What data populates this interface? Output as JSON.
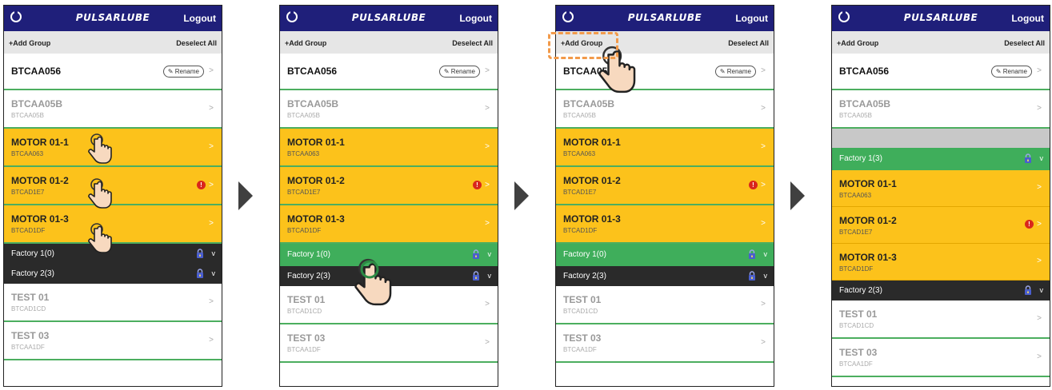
{
  "app": {
    "logo_text": "PULSARLUBE",
    "logout_label": "Logout",
    "add_group_label": "+Add Group",
    "deselect_label": "Deselect All",
    "rename_label": "Rename",
    "chevron": ">",
    "alert_glyph": "!",
    "group_chevron": "v"
  },
  "screens": [
    {
      "rows": [
        {
          "kind": "device",
          "style": "white",
          "title": "BTCAA056",
          "sub": "",
          "rename": true,
          "alert": false
        },
        {
          "kind": "device",
          "style": "gray",
          "title": "BTCAA05B",
          "sub": "BTCAA05B",
          "rename": false,
          "alert": false
        },
        {
          "kind": "device",
          "style": "yellow",
          "title": "MOTOR 01-1",
          "sub": "BTCAA063",
          "rename": false,
          "alert": false
        },
        {
          "kind": "device",
          "style": "yellow",
          "title": "MOTOR 01-2",
          "sub": "BTCAD1E7",
          "rename": false,
          "alert": true
        },
        {
          "kind": "device",
          "style": "yellow",
          "title": "MOTOR 01-3",
          "sub": "BTCAD1DF",
          "rename": false,
          "alert": false
        },
        {
          "kind": "group",
          "style": "dark",
          "title": "Factory 1(0)"
        },
        {
          "kind": "group",
          "style": "dark",
          "title": "Factory 2(3)"
        },
        {
          "kind": "device",
          "style": "gray",
          "title": "TEST 01",
          "sub": "BTCAD1CD",
          "rename": false,
          "alert": false
        },
        {
          "kind": "device",
          "style": "gray",
          "title": "TEST 03",
          "sub": "BTCAA1DF",
          "rename": false,
          "alert": false
        }
      ]
    },
    {
      "rows": [
        {
          "kind": "device",
          "style": "white",
          "title": "BTCAA056",
          "sub": "",
          "rename": true,
          "alert": false
        },
        {
          "kind": "device",
          "style": "gray",
          "title": "BTCAA05B",
          "sub": "BTCAA05B",
          "rename": false,
          "alert": false
        },
        {
          "kind": "device",
          "style": "yellow",
          "title": "MOTOR 01-1",
          "sub": "BTCAA063",
          "rename": false,
          "alert": false
        },
        {
          "kind": "device",
          "style": "yellow",
          "title": "MOTOR 01-2",
          "sub": "BTCAD1E7",
          "rename": false,
          "alert": true
        },
        {
          "kind": "device",
          "style": "yellow",
          "title": "MOTOR 01-3",
          "sub": "BTCAD1DF",
          "rename": false,
          "alert": false
        },
        {
          "kind": "group",
          "style": "green",
          "title": "Factory 1(0)"
        },
        {
          "kind": "group",
          "style": "dark",
          "title": "Factory 2(3)"
        },
        {
          "kind": "device",
          "style": "gray",
          "title": "TEST 01",
          "sub": "BTCAD1CD",
          "rename": false,
          "alert": false
        },
        {
          "kind": "device",
          "style": "gray",
          "title": "TEST 03",
          "sub": "BTCAA1DF",
          "rename": false,
          "alert": false
        }
      ]
    },
    {
      "rows": [
        {
          "kind": "device",
          "style": "white",
          "title": "BTCAA056",
          "sub": "",
          "rename": true,
          "alert": false
        },
        {
          "kind": "device",
          "style": "gray",
          "title": "BTCAA05B",
          "sub": "BTCAA05B",
          "rename": false,
          "alert": false
        },
        {
          "kind": "device",
          "style": "yellow",
          "title": "MOTOR 01-1",
          "sub": "BTCAA063",
          "rename": false,
          "alert": false
        },
        {
          "kind": "device",
          "style": "yellow",
          "title": "MOTOR 01-2",
          "sub": "BTCAD1E7",
          "rename": false,
          "alert": true
        },
        {
          "kind": "device",
          "style": "yellow",
          "title": "MOTOR 01-3",
          "sub": "BTCAD1DF",
          "rename": false,
          "alert": false
        },
        {
          "kind": "group",
          "style": "green",
          "title": "Factory 1(0)"
        },
        {
          "kind": "group",
          "style": "dark",
          "title": "Factory 2(3)"
        },
        {
          "kind": "device",
          "style": "gray",
          "title": "TEST 01",
          "sub": "BTCAD1CD",
          "rename": false,
          "alert": false
        },
        {
          "kind": "device",
          "style": "gray",
          "title": "TEST 03",
          "sub": "BTCAA1DF",
          "rename": false,
          "alert": false
        }
      ]
    },
    {
      "rows": [
        {
          "kind": "device",
          "style": "white",
          "title": "BTCAA056",
          "sub": "",
          "rename": true,
          "alert": false
        },
        {
          "kind": "device",
          "style": "gray",
          "title": "BTCAA05B",
          "sub": "BTCAA05B",
          "rename": false,
          "alert": false
        },
        {
          "kind": "band"
        },
        {
          "kind": "group",
          "style": "green",
          "title": "Factory 1(3)"
        },
        {
          "kind": "device",
          "style": "yellow-thin",
          "title": "MOTOR 01-1",
          "sub": "BTCAA063",
          "rename": false,
          "alert": false
        },
        {
          "kind": "device",
          "style": "yellow-thin",
          "title": "MOTOR 01-2",
          "sub": "BTCAD1E7",
          "rename": false,
          "alert": true
        },
        {
          "kind": "device",
          "style": "yellow-thin",
          "title": "MOTOR 01-3",
          "sub": "BTCAD1DF",
          "rename": false,
          "alert": false
        },
        {
          "kind": "group",
          "style": "dark",
          "title": "Factory 2(3)"
        },
        {
          "kind": "device",
          "style": "gray",
          "title": "TEST 01",
          "sub": "BTCAD1CD",
          "rename": false,
          "alert": false
        },
        {
          "kind": "device",
          "style": "gray",
          "title": "TEST 03",
          "sub": "BTCAA1DF",
          "rename": false,
          "alert": false
        }
      ]
    }
  ],
  "colors": {
    "header": "#1f1f7a",
    "selected_row": "#fcc21b",
    "group_dark": "#2a2a2a",
    "group_active": "#3fae5b",
    "alert": "#d9261c",
    "highlight": "#f29a4a"
  },
  "gestures": [
    "tap-hand-icon",
    "tap-hand-icon",
    "tap-hand-icon",
    "tap-hand-icon",
    "tap-hand-icon"
  ]
}
